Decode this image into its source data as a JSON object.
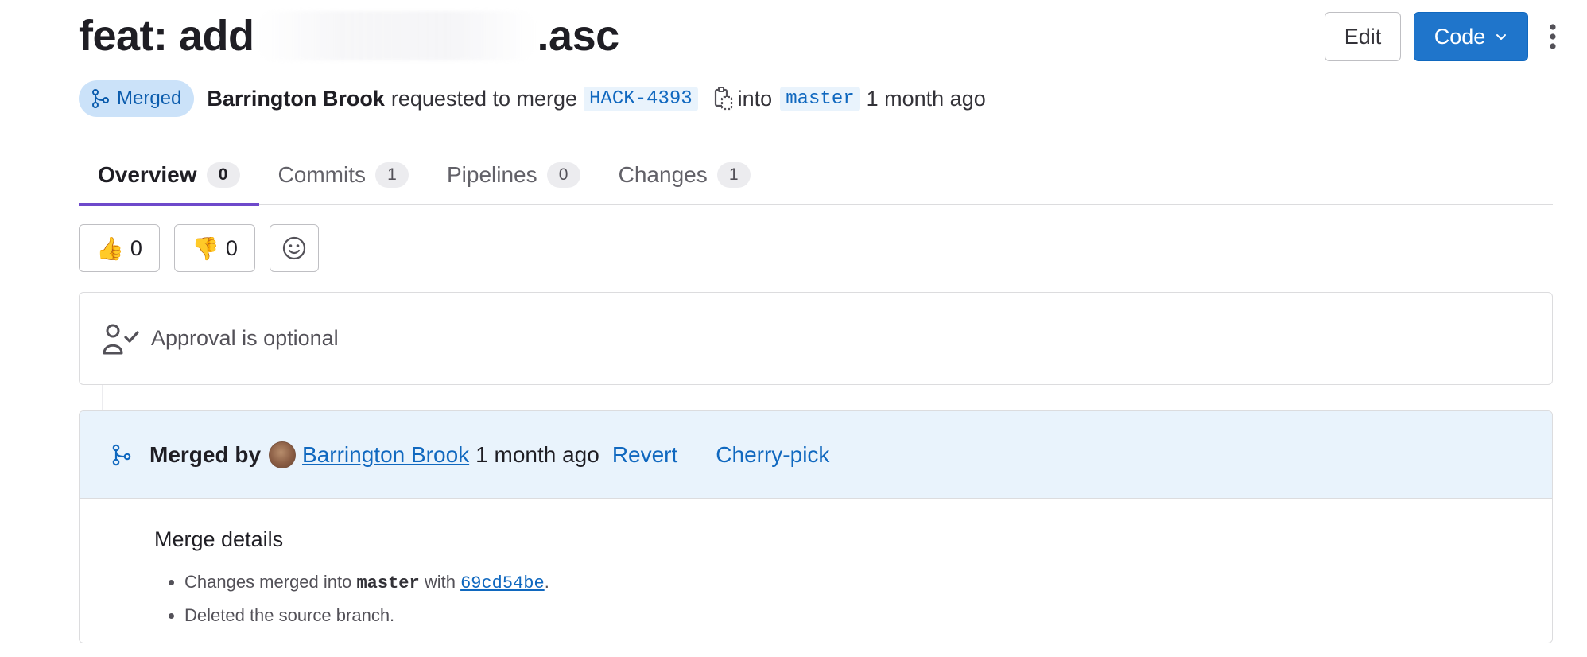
{
  "header": {
    "title_prefix": "feat: add",
    "title_suffix": ".asc",
    "edit_label": "Edit",
    "code_label": "Code"
  },
  "meta": {
    "status": "Merged",
    "author": "Barrington Brook",
    "requested_text": "requested to merge",
    "source_branch": "HACK-4393",
    "into_text": "into",
    "target_branch": "master",
    "time": "1 month ago"
  },
  "tabs": [
    {
      "label": "Overview",
      "count": "0",
      "active": true
    },
    {
      "label": "Commits",
      "count": "1",
      "active": false
    },
    {
      "label": "Pipelines",
      "count": "0",
      "active": false
    },
    {
      "label": "Changes",
      "count": "1",
      "active": false
    }
  ],
  "reactions": {
    "thumbs_up": {
      "emoji": "👍",
      "count": "0"
    },
    "thumbs_down": {
      "emoji": "👎",
      "count": "0"
    }
  },
  "approval": {
    "text": "Approval is optional"
  },
  "merge": {
    "merged_by": "Merged by",
    "author": "Barrington Brook",
    "time": "1 month ago",
    "revert": "Revert",
    "cherry_pick": "Cherry-pick",
    "details_title": "Merge details",
    "line1_prefix": "Changes merged into",
    "line1_branch": "master",
    "line1_with": "with",
    "line1_sha": "69cd54be",
    "line1_end": ".",
    "line2": "Deleted the source branch."
  },
  "colors": {
    "primary": "#1f75cb",
    "link": "#1068bf",
    "merged_badge_bg": "#cbe2f9",
    "merge_header_bg": "#e9f3fc",
    "active_tab": "#6e49cb"
  },
  "icons": {
    "status": "merge-request-icon",
    "copy": "copy-to-clipboard-icon",
    "approval": "approval-icon",
    "add_reaction": "smiley-icon",
    "menu": "kebab-menu-icon",
    "dropdown": "chevron-down-icon"
  }
}
